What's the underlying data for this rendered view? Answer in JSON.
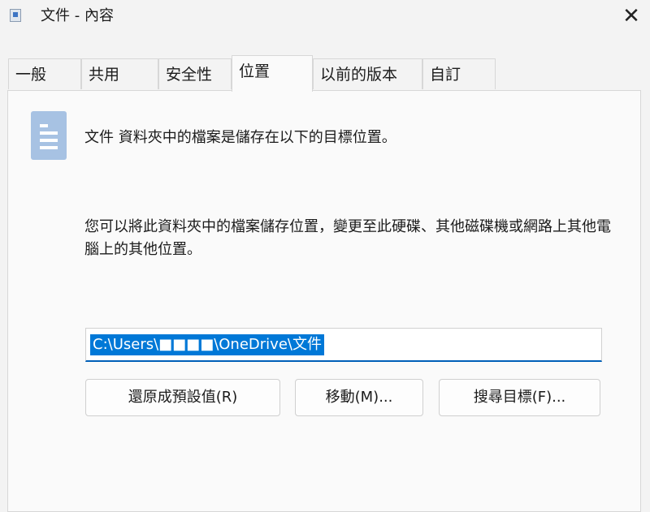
{
  "window": {
    "title": "文件 - 內容",
    "icon": "document-properties-icon",
    "close_icon": "✕"
  },
  "tabs": [
    {
      "label": "一般"
    },
    {
      "label": "共用"
    },
    {
      "label": "安全性"
    },
    {
      "label": "位置",
      "selected": true
    },
    {
      "label": "以前的版本"
    },
    {
      "label": "自訂"
    }
  ],
  "location": {
    "folder_icon": "document-library-icon",
    "description": "文件 資料夾中的檔案是儲存在以下的目標位置。",
    "info": "您可以將此資料夾中的檔案儲存位置，變更至此硬碟、其他磁碟機或網路上其他電腦上的其他位置。",
    "path_value": "C:\\Users\\■■■■\\OneDrive\\文件",
    "buttons": {
      "restore": "還原成預設值(R)",
      "move": "移動(M)...",
      "find_target": "搜尋目標(F)..."
    }
  },
  "colors": {
    "accent": "#0078d7",
    "doc_icon": "#a7c2e3"
  }
}
